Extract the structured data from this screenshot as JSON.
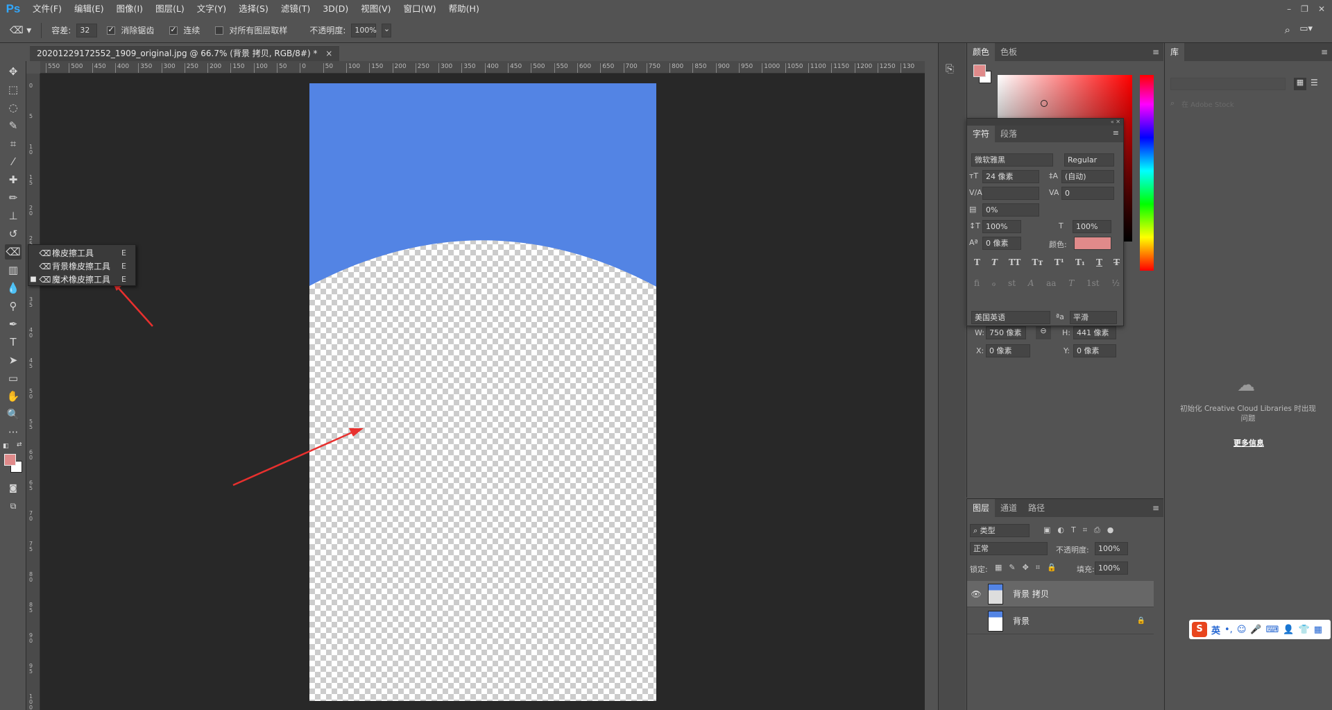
{
  "app": {
    "logo": "Ps"
  },
  "menu": [
    "文件(F)",
    "编辑(E)",
    "图像(I)",
    "图层(L)",
    "文字(Y)",
    "选择(S)",
    "滤镜(T)",
    "3D(D)",
    "视图(V)",
    "窗口(W)",
    "帮助(H)"
  ],
  "window_controls": [
    "–",
    "❐",
    "✕"
  ],
  "options": {
    "tolerance_label": "容差:",
    "tolerance_value": "32",
    "antialias_label": "消除锯齿",
    "contiguous_label": "连续",
    "sample_all_label": "对所有图层取样",
    "opacity_label": "不透明度:",
    "opacity_value": "100%"
  },
  "document_tab": {
    "title": "20201229172552_1909_original.jpg @ 66.7% (背景 拷贝, RGB/8#) *",
    "close": "×"
  },
  "ruler_top_labels": [
    "550",
    "500",
    "450",
    "400",
    "350",
    "300",
    "250",
    "200",
    "150",
    "100",
    "50",
    "0",
    "50",
    "100",
    "150",
    "200",
    "250",
    "300",
    "350",
    "400",
    "450",
    "500",
    "550",
    "600",
    "650",
    "700",
    "750",
    "800",
    "850",
    "900",
    "950",
    "1000",
    "1050",
    "1100",
    "1150",
    "1200",
    "1250",
    "130"
  ],
  "ruler_left_labels": [
    "0",
    "5",
    "1 0",
    "1 5",
    "2 0",
    "2 5",
    "3 0",
    "3 5",
    "4 0",
    "4 5",
    "5 0",
    "5 5",
    "6 0",
    "6 5",
    "7 0",
    "7 5",
    "8 0",
    "8 5",
    "9 0",
    "9 5",
    "1 0 0"
  ],
  "flyout": {
    "items": [
      {
        "label": "橡皮擦工具",
        "key": "E",
        "selected": false
      },
      {
        "label": "背景橡皮擦工具",
        "key": "E",
        "selected": false
      },
      {
        "label": "魔术橡皮擦工具",
        "key": "E",
        "selected": true
      }
    ]
  },
  "color_panel": {
    "tabs": [
      "颜色",
      "色板"
    ],
    "fg_color": "#e08a8a",
    "bg_color": "#ffffff"
  },
  "character_panel": {
    "tabs": [
      "字符",
      "段落"
    ],
    "font_family": "微软雅黑",
    "font_style": "Regular",
    "font_size": "24 像素",
    "leading": "(自动)",
    "kerning": "",
    "tracking": "0",
    "tsume": "0%",
    "vertical_scale": "100%",
    "horizontal_scale": "100%",
    "baseline_shift": "0 像素",
    "color_label": "颜色:",
    "color_value": "#e08a8a",
    "style_buttons": [
      "T",
      "T",
      "TT",
      "Tт",
      "T¹",
      "T₁",
      "T",
      "T"
    ],
    "opentype_buttons": [
      "fi",
      "ℴ",
      "st",
      "A",
      "aa",
      "T",
      "1st",
      "½"
    ],
    "language": "美国英语",
    "aa_icon": "ªa",
    "antialias": "平滑"
  },
  "properties": {
    "w_label": "W:",
    "w_value": "750 像素",
    "h_label": "H:",
    "h_value": "441 像素",
    "x_label": "X:",
    "x_value": "0 像素",
    "y_label": "Y:",
    "y_value": "0 像素"
  },
  "layers_panel": {
    "tabs": [
      "图层",
      "通道",
      "路径"
    ],
    "filter_label": "类型",
    "blend_mode": "正常",
    "opacity_label": "不透明度:",
    "opacity_value": "100%",
    "lock_label": "锁定:",
    "fill_label": "填充:",
    "fill_value": "100%",
    "layers": [
      {
        "name": "背景 拷贝",
        "visible": true,
        "selected": true,
        "locked": false
      },
      {
        "name": "背景",
        "visible": false,
        "selected": false,
        "locked": true
      }
    ]
  },
  "library_panel": {
    "tab": "库",
    "search_placeholder": "在 Adobe Stock",
    "message": "初始化 Creative Cloud Libraries 时出现问题",
    "more_info": "更多信息"
  },
  "ime": {
    "logo": "S",
    "lang": "英"
  },
  "colors": {
    "canvas_blue": "#5384e4",
    "accent": "#31a8ff",
    "arrow": "#e8302e"
  }
}
